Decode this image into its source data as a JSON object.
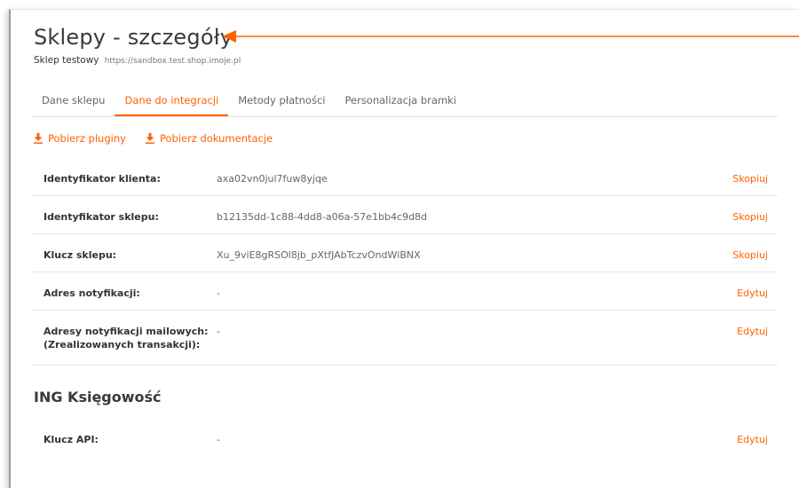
{
  "page": {
    "title": "Sklepy - szczegóły",
    "shop_name": "Sklep testowy",
    "shop_url": "https://sandbox.test.shop.imoje.pl"
  },
  "tabs": [
    {
      "label": "Dane sklepu",
      "active": false
    },
    {
      "label": "Dane do integracji",
      "active": true
    },
    {
      "label": "Metody płatności",
      "active": false
    },
    {
      "label": "Personalizacja bramki",
      "active": false
    }
  ],
  "downloads": {
    "plugins": "Pobierz pluginy",
    "docs": "Pobierz dokumentacje"
  },
  "details": [
    {
      "label": "Identyfikator klienta:",
      "value": "axa02vn0jul7fuw8yjqe",
      "action": "Skopiuj"
    },
    {
      "label": "Identyfikator sklepu:",
      "value": "b12135dd-1c88-4dd8-a06a-57e1bb4c9d8d",
      "action": "Skopiuj"
    },
    {
      "label": "Klucz sklepu:",
      "value": "Xu_9viE8gRSOl8jb_pXtfJAbTczvOndWlBNX",
      "action": "Skopiuj"
    },
    {
      "label": "Adres notyfikacji:",
      "value": "-",
      "action": "Edytuj"
    },
    {
      "label_line1": "Adresy notyfikacji mailowych:",
      "label_line2": "(Zrealizowanych transakcji):",
      "value": "-",
      "action": "Edytuj"
    }
  ],
  "ing_section": {
    "title": "ING Księgowość",
    "rows": [
      {
        "label": "Klucz API:",
        "value": "-",
        "action": "Edytuj"
      }
    ]
  },
  "colors": {
    "accent": "#ff6200",
    "text": "#333333",
    "muted": "#666666",
    "divider": "#e6e6e6"
  },
  "icons": {
    "download": "download-icon",
    "arrow": "annotation-arrow"
  }
}
